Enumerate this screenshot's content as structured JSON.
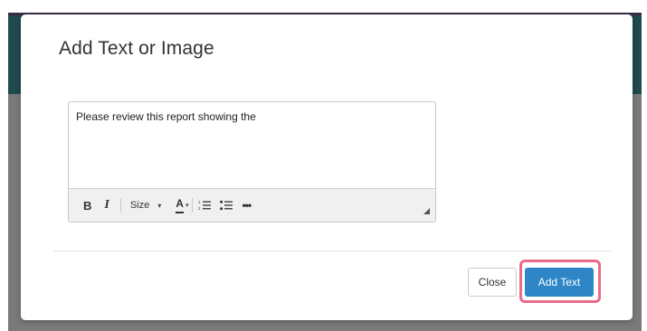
{
  "modal": {
    "title": "Add Text or Image"
  },
  "editor": {
    "content": "Please review this report showing the",
    "toolbar": {
      "bold_label": "B",
      "italic_label": "I",
      "size_label": "Size",
      "size_caret": "▾",
      "font_color_label": "A",
      "font_color_caret": "▾",
      "ordered_list_icon": "ordered-list-icon",
      "unordered_list_icon": "unordered-list-icon",
      "more_label": "•••"
    }
  },
  "footer": {
    "close_label": "Close",
    "add_text_label": "Add Text"
  },
  "colors": {
    "primary_button": "#2e86c7",
    "highlight_ring": "#e96b8a",
    "backdrop_band": "#1f4a4e"
  }
}
